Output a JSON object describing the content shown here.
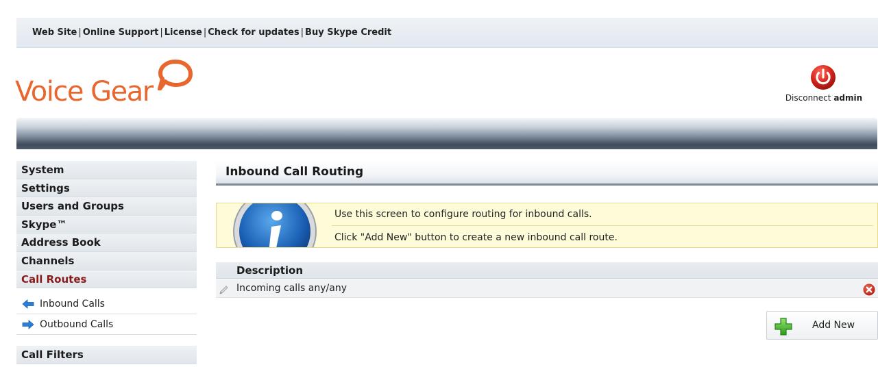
{
  "topbar": {
    "links": [
      "Web Site",
      "Online Support",
      "License",
      "Check for updates",
      "Buy Skype Credit"
    ]
  },
  "logo": {
    "text": "Voice Gear",
    "color": "#e8672f"
  },
  "account": {
    "disconnect_label": "Disconnect",
    "username": "admin",
    "icon": "power-icon"
  },
  "sidebar": {
    "items": [
      {
        "label": "System"
      },
      {
        "label": "Settings"
      },
      {
        "label": "Users and Groups"
      },
      {
        "label": "Skype™"
      },
      {
        "label": "Address Book"
      },
      {
        "label": "Channels"
      },
      {
        "label": "Call Routes"
      }
    ],
    "sub_items": [
      {
        "label": "Inbound Calls",
        "icon": "arrow-left-icon"
      },
      {
        "label": "Outbound Calls",
        "icon": "arrow-right-icon"
      }
    ],
    "filters_label": "Call Filters",
    "active_color": "#8b1a1a"
  },
  "main": {
    "title": "Inbound Call Routing",
    "info": {
      "line1": "Use this screen to configure routing for inbound calls.",
      "line2": "Click \"Add New\" button to create a new inbound call route."
    },
    "table": {
      "header": "Description",
      "rows": [
        {
          "description": "Incoming calls any/any"
        }
      ]
    },
    "add_button_label": "Add New"
  }
}
